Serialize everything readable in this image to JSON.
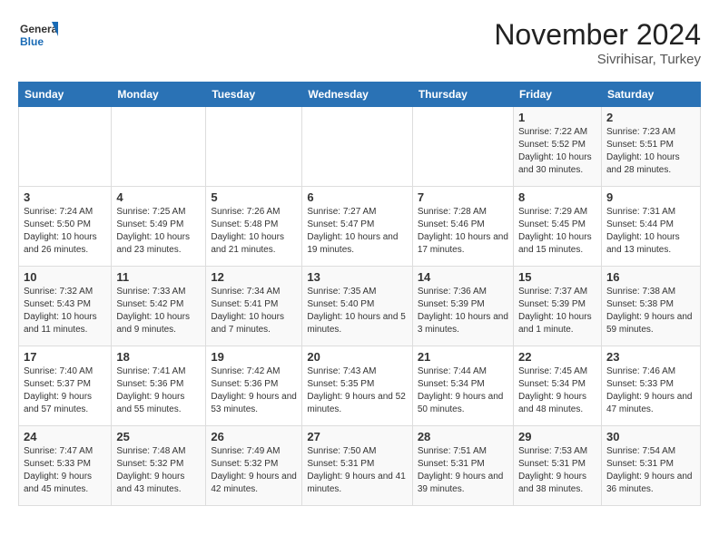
{
  "header": {
    "logo_line1": "General",
    "logo_line2": "Blue",
    "month": "November 2024",
    "location": "Sivrihisar, Turkey"
  },
  "days_of_week": [
    "Sunday",
    "Monday",
    "Tuesday",
    "Wednesday",
    "Thursday",
    "Friday",
    "Saturday"
  ],
  "weeks": [
    [
      {
        "day": "",
        "info": ""
      },
      {
        "day": "",
        "info": ""
      },
      {
        "day": "",
        "info": ""
      },
      {
        "day": "",
        "info": ""
      },
      {
        "day": "",
        "info": ""
      },
      {
        "day": "1",
        "info": "Sunrise: 7:22 AM\nSunset: 5:52 PM\nDaylight: 10 hours\nand 30 minutes."
      },
      {
        "day": "2",
        "info": "Sunrise: 7:23 AM\nSunset: 5:51 PM\nDaylight: 10 hours\nand 28 minutes."
      }
    ],
    [
      {
        "day": "3",
        "info": "Sunrise: 7:24 AM\nSunset: 5:50 PM\nDaylight: 10 hours\nand 26 minutes."
      },
      {
        "day": "4",
        "info": "Sunrise: 7:25 AM\nSunset: 5:49 PM\nDaylight: 10 hours\nand 23 minutes."
      },
      {
        "day": "5",
        "info": "Sunrise: 7:26 AM\nSunset: 5:48 PM\nDaylight: 10 hours\nand 21 minutes."
      },
      {
        "day": "6",
        "info": "Sunrise: 7:27 AM\nSunset: 5:47 PM\nDaylight: 10 hours\nand 19 minutes."
      },
      {
        "day": "7",
        "info": "Sunrise: 7:28 AM\nSunset: 5:46 PM\nDaylight: 10 hours\nand 17 minutes."
      },
      {
        "day": "8",
        "info": "Sunrise: 7:29 AM\nSunset: 5:45 PM\nDaylight: 10 hours\nand 15 minutes."
      },
      {
        "day": "9",
        "info": "Sunrise: 7:31 AM\nSunset: 5:44 PM\nDaylight: 10 hours\nand 13 minutes."
      }
    ],
    [
      {
        "day": "10",
        "info": "Sunrise: 7:32 AM\nSunset: 5:43 PM\nDaylight: 10 hours\nand 11 minutes."
      },
      {
        "day": "11",
        "info": "Sunrise: 7:33 AM\nSunset: 5:42 PM\nDaylight: 10 hours\nand 9 minutes."
      },
      {
        "day": "12",
        "info": "Sunrise: 7:34 AM\nSunset: 5:41 PM\nDaylight: 10 hours\nand 7 minutes."
      },
      {
        "day": "13",
        "info": "Sunrise: 7:35 AM\nSunset: 5:40 PM\nDaylight: 10 hours\nand 5 minutes."
      },
      {
        "day": "14",
        "info": "Sunrise: 7:36 AM\nSunset: 5:39 PM\nDaylight: 10 hours\nand 3 minutes."
      },
      {
        "day": "15",
        "info": "Sunrise: 7:37 AM\nSunset: 5:39 PM\nDaylight: 10 hours\nand 1 minute."
      },
      {
        "day": "16",
        "info": "Sunrise: 7:38 AM\nSunset: 5:38 PM\nDaylight: 9 hours\nand 59 minutes."
      }
    ],
    [
      {
        "day": "17",
        "info": "Sunrise: 7:40 AM\nSunset: 5:37 PM\nDaylight: 9 hours\nand 57 minutes."
      },
      {
        "day": "18",
        "info": "Sunrise: 7:41 AM\nSunset: 5:36 PM\nDaylight: 9 hours\nand 55 minutes."
      },
      {
        "day": "19",
        "info": "Sunrise: 7:42 AM\nSunset: 5:36 PM\nDaylight: 9 hours\nand 53 minutes."
      },
      {
        "day": "20",
        "info": "Sunrise: 7:43 AM\nSunset: 5:35 PM\nDaylight: 9 hours\nand 52 minutes."
      },
      {
        "day": "21",
        "info": "Sunrise: 7:44 AM\nSunset: 5:34 PM\nDaylight: 9 hours\nand 50 minutes."
      },
      {
        "day": "22",
        "info": "Sunrise: 7:45 AM\nSunset: 5:34 PM\nDaylight: 9 hours\nand 48 minutes."
      },
      {
        "day": "23",
        "info": "Sunrise: 7:46 AM\nSunset: 5:33 PM\nDaylight: 9 hours\nand 47 minutes."
      }
    ],
    [
      {
        "day": "24",
        "info": "Sunrise: 7:47 AM\nSunset: 5:33 PM\nDaylight: 9 hours\nand 45 minutes."
      },
      {
        "day": "25",
        "info": "Sunrise: 7:48 AM\nSunset: 5:32 PM\nDaylight: 9 hours\nand 43 minutes."
      },
      {
        "day": "26",
        "info": "Sunrise: 7:49 AM\nSunset: 5:32 PM\nDaylight: 9 hours\nand 42 minutes."
      },
      {
        "day": "27",
        "info": "Sunrise: 7:50 AM\nSunset: 5:31 PM\nDaylight: 9 hours\nand 41 minutes."
      },
      {
        "day": "28",
        "info": "Sunrise: 7:51 AM\nSunset: 5:31 PM\nDaylight: 9 hours\nand 39 minutes."
      },
      {
        "day": "29",
        "info": "Sunrise: 7:53 AM\nSunset: 5:31 PM\nDaylight: 9 hours\nand 38 minutes."
      },
      {
        "day": "30",
        "info": "Sunrise: 7:54 AM\nSunset: 5:31 PM\nDaylight: 9 hours\nand 36 minutes."
      }
    ]
  ]
}
